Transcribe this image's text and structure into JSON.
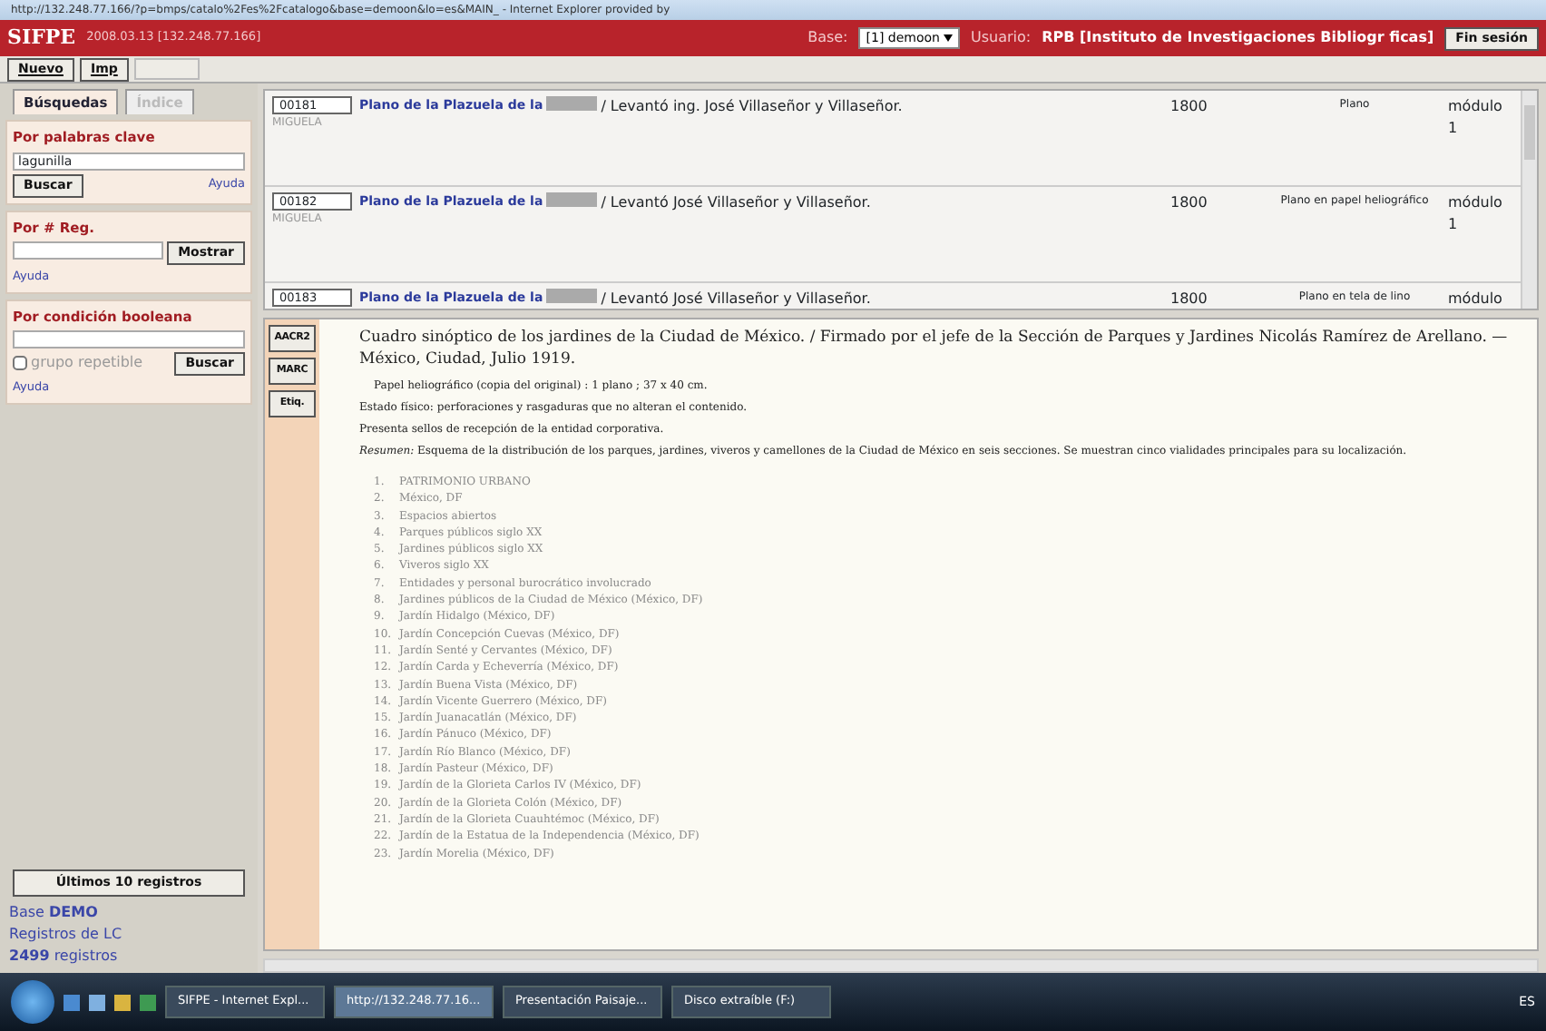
{
  "window": {
    "title": "http://132.248.77.166/?p=bmps/catalo%2Fes%2Fcatalogo&base=demoon&lo=es&MAIN_ - Internet Explorer provided by"
  },
  "header": {
    "app": "SIFPE",
    "version": "2008.03.13 [132.248.77.166]",
    "base_label": "Base:",
    "base_value": "[1] demoon",
    "user_label": "Usuario:",
    "user": "RPB [Instituto de Investigaciones Bibliogr ficas]",
    "logout": "Fin sesión"
  },
  "toolbar": [
    {
      "kind": "text",
      "label": "Nuevo",
      "disabled": false
    },
    {
      "kind": "text",
      "label": "Imp",
      "disabled": false
    },
    {
      "kind": "blank",
      "disabled": true
    }
  ],
  "sidebar": {
    "tabs": [
      {
        "label": "Búsquedas",
        "selected": true
      },
      {
        "label": "Índice",
        "selected": false
      }
    ],
    "keyword": {
      "title": "Por palabras clave",
      "value": "lagunilla",
      "button": "Buscar",
      "help": "Ayuda"
    },
    "regnum": {
      "title": "Por # Reg.",
      "button": "Mostrar",
      "help": "Ayuda"
    },
    "boolean": {
      "title": "Por condición booleana",
      "checkbox": "grupo repetible",
      "checked": false,
      "button": "Buscar",
      "help": "Ayuda"
    },
    "recent_button": "Últimos 10 registros",
    "base_label": "Base",
    "base_name": "DEMO",
    "records_label": "Registros de LC",
    "count": "2499",
    "count_label": "registros"
  },
  "records": [
    {
      "number": "00181",
      "title": "Plano de la Plazuela de la",
      "author": "/ Levantó ing. José Villaseñor y Villaseñor.",
      "code": "MIGUELA",
      "year": "1800",
      "type": "Plano",
      "location": "módulo 1"
    },
    {
      "number": "00182",
      "title": "Plano de la Plazuela de la",
      "author": "/ Levantó José Villaseñor y Villaseñor.",
      "code": "MIGUELA",
      "year": "1800",
      "type": "Plano en papel heliográfico",
      "location": "módulo 1"
    },
    {
      "number": "00183",
      "title": "Plano de la Plazuela de la",
      "author": "/ Levantó José Villaseñor y Villaseñor.",
      "year": "1800",
      "type": "Plano en tela de lino",
      "location": "módulo"
    }
  ],
  "detail": {
    "buttons": [
      "AACR2",
      "MARC",
      "Etiq."
    ],
    "description": "Cuadro sinóptico de los jardines de la Ciudad de México. / Firmado por el jefe de la Sección de Parques y Jardines Nicolás Ramírez de Arellano. — México, Ciudad, Julio 1919.",
    "physical": "Papel heliográfico (copia del original) : 1 plano ; 37 x 40 cm.",
    "notes": [
      "Estado físico: perforaciones y rasgaduras que no alteran el contenido.",
      "Presenta sellos de recepción de la entidad corporativa."
    ],
    "summary": "*Resumen:* Esquema de la distribución de los parques, jardines, viveros y camellones de la Ciudad de México en seis secciones. Se muestran cinco vialidades principales para su localización.",
    "subjects": [
      {
        "n": "1.",
        "text": "PATRIMONIO URBANO"
      },
      {
        "n": "2.",
        "text": "México, DF"
      },
      {
        "n": "3.",
        "text": "Espacios abiertos"
      },
      {
        "n": "4.",
        "text": "Parques públicos siglo XX"
      },
      {
        "n": "5.",
        "text": "Jardines públicos siglo XX"
      },
      {
        "n": "6.",
        "text": "Viveros siglo XX"
      },
      {
        "n": "7.",
        "text": "Entidades y personal burocrático involucrado"
      },
      {
        "n": "8.",
        "text": "Jardines públicos de la Ciudad de México (México, DF)"
      },
      {
        "n": "9.",
        "text": "Jardín Hidalgo (México, DF)"
      },
      {
        "n": "10.",
        "text": "Jardín Concepción Cuevas (México, DF)"
      },
      {
        "n": "11.",
        "text": "Jardín Senté y Cervantes (México, DF)"
      },
      {
        "n": "12.",
        "text": "Jardín Carda y Echeverría (México, DF)"
      },
      {
        "n": "13.",
        "text": "Jardín Buena Vista (México, DF)"
      },
      {
        "n": "14.",
        "text": "Jardín Vicente Guerrero (México, DF)"
      },
      {
        "n": "15.",
        "text": "Jardín Juanacatlán (México, DF)"
      },
      {
        "n": "16.",
        "text": "Jardín Pánuco (México, DF)"
      },
      {
        "n": "17.",
        "text": "Jardín Río Blanco (México, DF)"
      },
      {
        "n": "18.",
        "text": "Jardín Pasteur (México, DF)"
      },
      {
        "n": "19.",
        "text": "Jardín de la Glorieta Carlos IV (México, DF)"
      },
      {
        "n": "20.",
        "text": "Jardín de la Glorieta Colón (México, DF)"
      },
      {
        "n": "21.",
        "text": "Jardín de la Glorieta Cuauhtémoc (México, DF)"
      },
      {
        "n": "22.",
        "text": "Jardín de la Estatua de la Independencia (México, DF)"
      },
      {
        "n": "23.",
        "text": "Jardín Morelia (México, DF)"
      }
    ]
  },
  "taskbar": {
    "tasks": [
      {
        "label": "SIFPE - Internet Expl...",
        "selected": false
      },
      {
        "label": "http://132.248.77.16...",
        "selected": true
      },
      {
        "label": "Presentación Paisaje...",
        "selected": false
      },
      {
        "label": "Disco extraíble (F:)",
        "selected": false
      }
    ],
    "tray": "ES"
  }
}
